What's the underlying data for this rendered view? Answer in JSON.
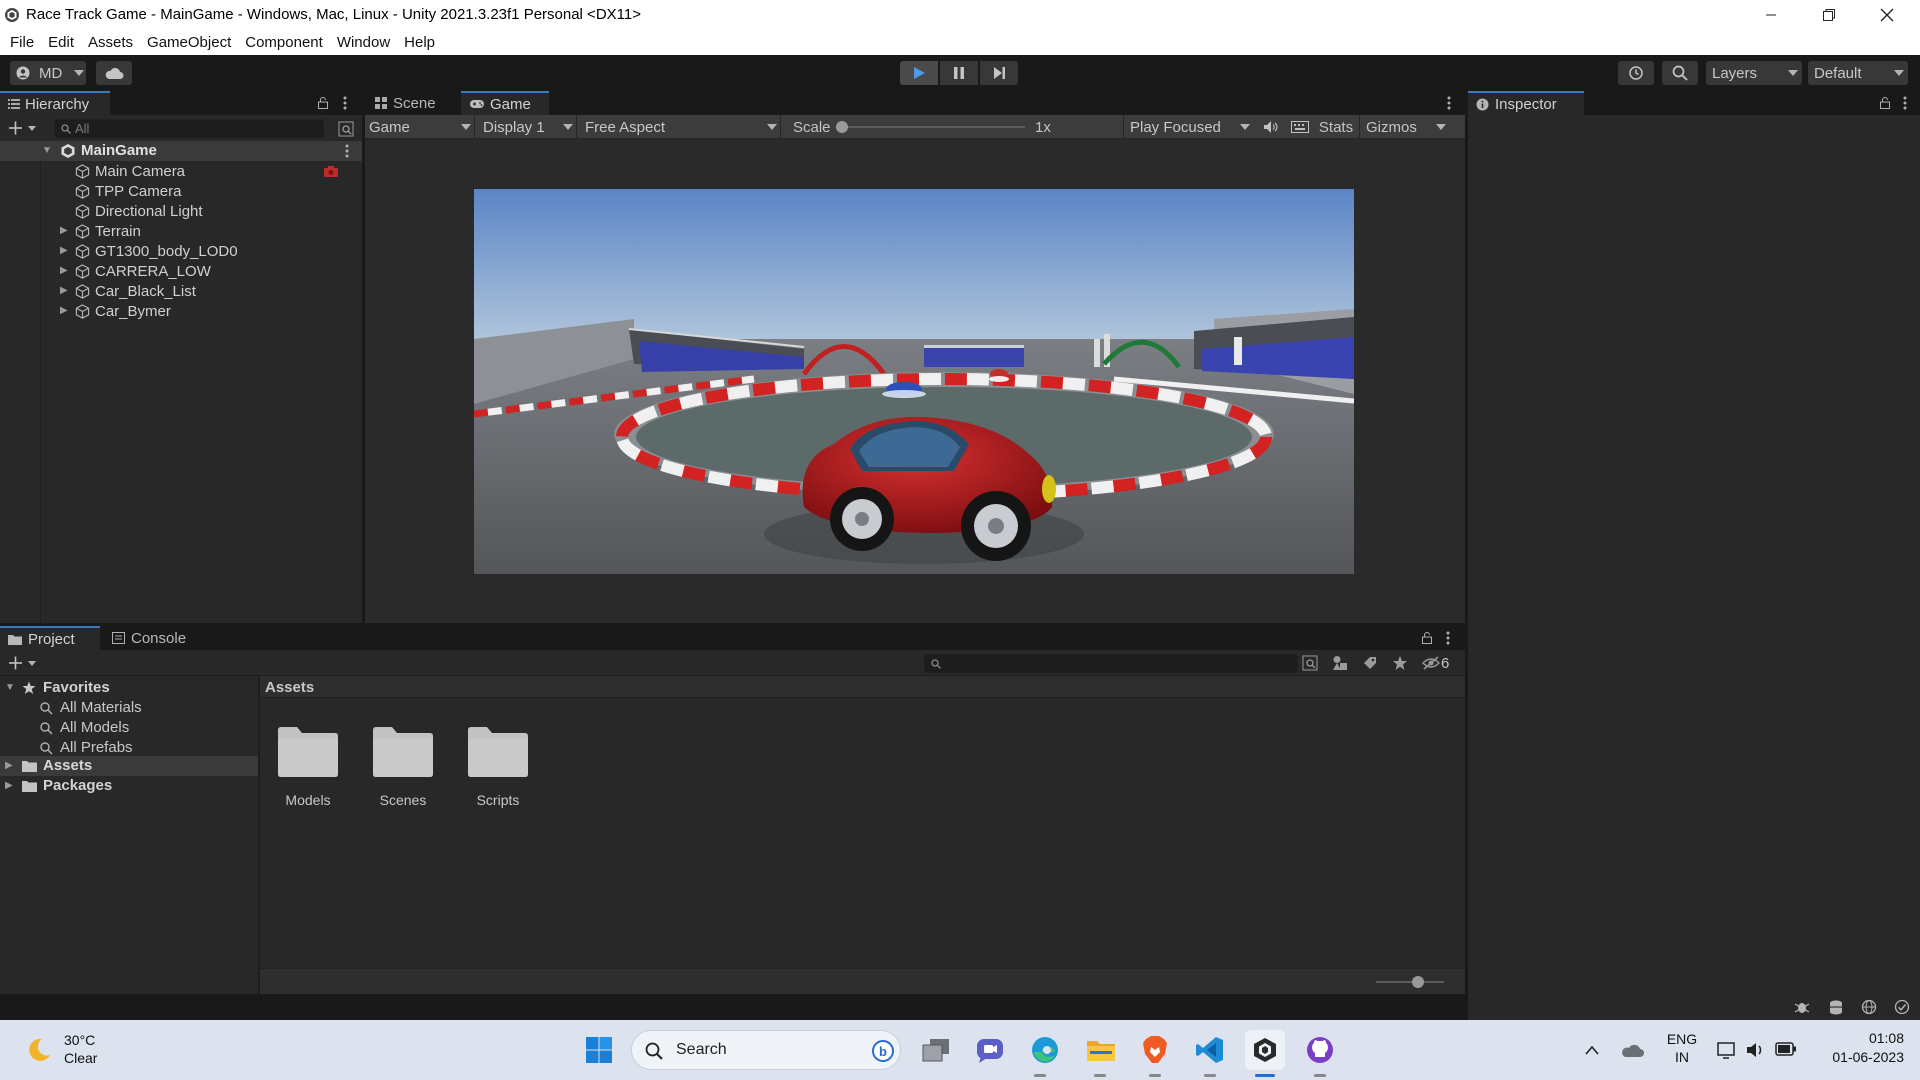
{
  "window": {
    "title": "Race Track Game - MainGame - Windows, Mac, Linux - Unity 2021.3.23f1 Personal <DX11>"
  },
  "menu": [
    "File",
    "Edit",
    "Assets",
    "GameObject",
    "Component",
    "Window",
    "Help"
  ],
  "toolbar": {
    "account": "MD",
    "layers": "Layers",
    "layout": "Default"
  },
  "hierarchy": {
    "tab": "Hierarchy",
    "search_placeholder": "All",
    "scene": "MainGame",
    "items": [
      {
        "label": "Main Camera",
        "expandable": false
      },
      {
        "label": "TPP Camera",
        "expandable": false
      },
      {
        "label": "Directional Light",
        "expandable": false
      },
      {
        "label": "Terrain",
        "expandable": true
      },
      {
        "label": "GT1300_body_LOD0",
        "expandable": true
      },
      {
        "label": "CARRERA_LOW",
        "expandable": true
      },
      {
        "label": "Car_Black_List",
        "expandable": true
      },
      {
        "label": "Car_Bymer",
        "expandable": true
      }
    ]
  },
  "game": {
    "tabs": [
      "Scene",
      "Game"
    ],
    "view_mode": "Game",
    "display": "Display 1",
    "aspect": "Free Aspect",
    "scale_label": "Scale",
    "scale_value": "1x",
    "play_mode": "Play Focused",
    "stats": "Stats",
    "gizmos": "Gizmos"
  },
  "inspector": {
    "tab": "Inspector"
  },
  "project": {
    "tabs": [
      "Project",
      "Console"
    ],
    "favorites_label": "Favorites",
    "favorites": [
      "All Materials",
      "All Models",
      "All Prefabs"
    ],
    "roots": [
      "Assets",
      "Packages"
    ],
    "breadcrumb": "Assets",
    "folders": [
      "Models",
      "Scenes",
      "Scripts"
    ],
    "hidden_count": "6"
  },
  "taskbar": {
    "weather_temp": "30°C",
    "weather_desc": "Clear",
    "search": "Search",
    "lang_top": "ENG",
    "lang_bottom": "IN",
    "time": "01:08",
    "date": "01-06-2023"
  },
  "colors": {
    "accent": "#3a79bb",
    "car": "#b8141b",
    "sky_top": "#5d86c8",
    "curb_red": "#d42424"
  }
}
